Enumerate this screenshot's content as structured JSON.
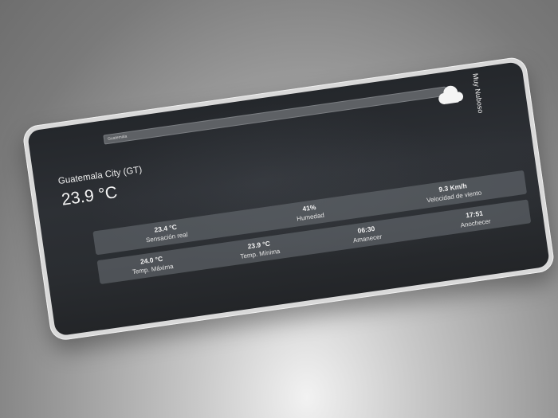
{
  "search": {
    "value": "Guatemala"
  },
  "weather": {
    "condition": "Muy Nuboso",
    "icon": "cloud-icon",
    "city": "Guatemala City (GT)",
    "temperature": "23.9 °C"
  },
  "stats_top": [
    {
      "value": "23.4 °C",
      "label": "Sensación real"
    },
    {
      "value": "41%",
      "label": "Humedad"
    },
    {
      "value": "9.3 Km/h",
      "label": "Velocidad de viento"
    }
  ],
  "stats_bottom": [
    {
      "value": "24.0 °C",
      "label": "Temp. Máxima"
    },
    {
      "value": "23.9 °C",
      "label": "Temp. Mínima"
    },
    {
      "value": "06:30",
      "label": "Amanecer"
    },
    {
      "value": "17:51",
      "label": "Anochecer"
    }
  ]
}
